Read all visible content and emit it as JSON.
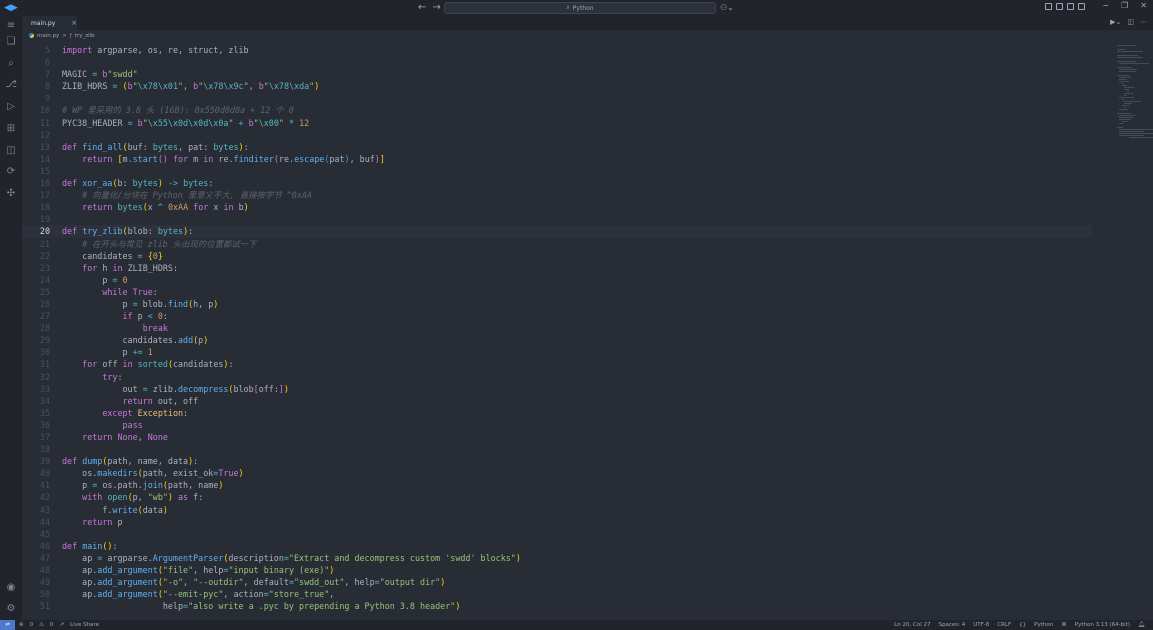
{
  "search": {
    "label": "Python",
    "icon": "search-icon"
  },
  "tabs": [
    {
      "label": "main.py",
      "close": "×"
    }
  ],
  "breadcrumb": {
    "file": "main.py",
    "separator": ">",
    "symbol": "try_zlib"
  },
  "statusbar": {
    "problems": "0",
    "warnings": "0",
    "live_share": "Live Share",
    "position": "Ln 20, Col 27",
    "spaces": "Spaces: 4",
    "encoding": "UTF-8",
    "eol": "CRLF",
    "language": "Python",
    "interpreter": "Python 3.13 (64-bit)"
  },
  "editor": {
    "current_line": 20,
    "lines": [
      {
        "n": 5,
        "t": "import argparse, os, re, struct, zlib"
      },
      {
        "n": 6,
        "t": ""
      },
      {
        "n": 7,
        "t": "MAGIC = b\"swdd\""
      },
      {
        "n": 8,
        "t": "ZLIB_HDRS = (b\"\\x78\\x01\", b\"\\x78\\x9c\", b\"\\x78\\xda\")"
      },
      {
        "n": 9,
        "t": ""
      },
      {
        "n": 10,
        "t": "# WP 里采用的 3.8 头 (16B): 0x550d0d0a + 12 个 0"
      },
      {
        "n": 11,
        "t": "PYC38_HEADER = b\"\\x55\\x0d\\x0d\\x0a\" + b\"\\x00\" * 12"
      },
      {
        "n": 12,
        "t": ""
      },
      {
        "n": 13,
        "t": "def find_all(buf: bytes, pat: bytes):"
      },
      {
        "n": 14,
        "t": "    return [m.start() for m in re.finditer(re.escape(pat), buf)]"
      },
      {
        "n": 15,
        "t": ""
      },
      {
        "n": 16,
        "t": "def xor_aa(b: bytes) -> bytes:"
      },
      {
        "n": 17,
        "t": "    # 向量化/分块在 Python 里意义不大, 直接按字节 ^0xAA"
      },
      {
        "n": 18,
        "t": "    return bytes(x ^ 0xAA for x in b)"
      },
      {
        "n": 19,
        "t": ""
      },
      {
        "n": 20,
        "t": "def try_zlib(blob: bytes):"
      },
      {
        "n": 21,
        "t": "    # 在开头与常见 zlib 头出现的位置都试一下"
      },
      {
        "n": 22,
        "t": "    candidates = {0}"
      },
      {
        "n": 23,
        "t": "    for h in ZLIB_HDRS:"
      },
      {
        "n": 24,
        "t": "        p = 0"
      },
      {
        "n": 25,
        "t": "        while True:"
      },
      {
        "n": 26,
        "t": "            p = blob.find(h, p)"
      },
      {
        "n": 27,
        "t": "            if p < 0:"
      },
      {
        "n": 28,
        "t": "                break"
      },
      {
        "n": 29,
        "t": "            candidates.add(p)"
      },
      {
        "n": 30,
        "t": "            p += 1"
      },
      {
        "n": 31,
        "t": "    for off in sorted(candidates):"
      },
      {
        "n": 32,
        "t": "        try:"
      },
      {
        "n": 33,
        "t": "            out = zlib.decompress(blob[off:])"
      },
      {
        "n": 34,
        "t": "            return out, off"
      },
      {
        "n": 35,
        "t": "        except Exception:"
      },
      {
        "n": 36,
        "t": "            pass"
      },
      {
        "n": 37,
        "t": "    return None, None"
      },
      {
        "n": 38,
        "t": ""
      },
      {
        "n": 39,
        "t": "def dump(path, name, data):"
      },
      {
        "n": 40,
        "t": "    os.makedirs(path, exist_ok=True)"
      },
      {
        "n": 41,
        "t": "    p = os.path.join(path, name)"
      },
      {
        "n": 42,
        "t": "    with open(p, \"wb\") as f:"
      },
      {
        "n": 43,
        "t": "        f.write(data)"
      },
      {
        "n": 44,
        "t": "    return p"
      },
      {
        "n": 45,
        "t": ""
      },
      {
        "n": 46,
        "t": "def main():"
      },
      {
        "n": 47,
        "t": "    ap = argparse.ArgumentParser(description=\"Extract and decompress custom 'swdd' blocks\")"
      },
      {
        "n": 48,
        "t": "    ap.add_argument(\"file\", help=\"input binary (exe)\")"
      },
      {
        "n": 49,
        "t": "    ap.add_argument(\"-o\", \"--outdir\", default=\"swdd_out\", help=\"output dir\")"
      },
      {
        "n": 50,
        "t": "    ap.add_argument(\"--emit-pyc\", action=\"store_true\","
      },
      {
        "n": 51,
        "t": "                    help=\"also write a .pyc by prepending a Python 3.8 header\")"
      }
    ]
  },
  "colors": {
    "editor_bg": "#282c34",
    "chrome_bg": "#21252b",
    "keyword": "#c678dd",
    "function": "#61afef",
    "string": "#98c379",
    "number": "#d19a66",
    "comment": "#5c6370",
    "accent": "#4d78cc"
  }
}
